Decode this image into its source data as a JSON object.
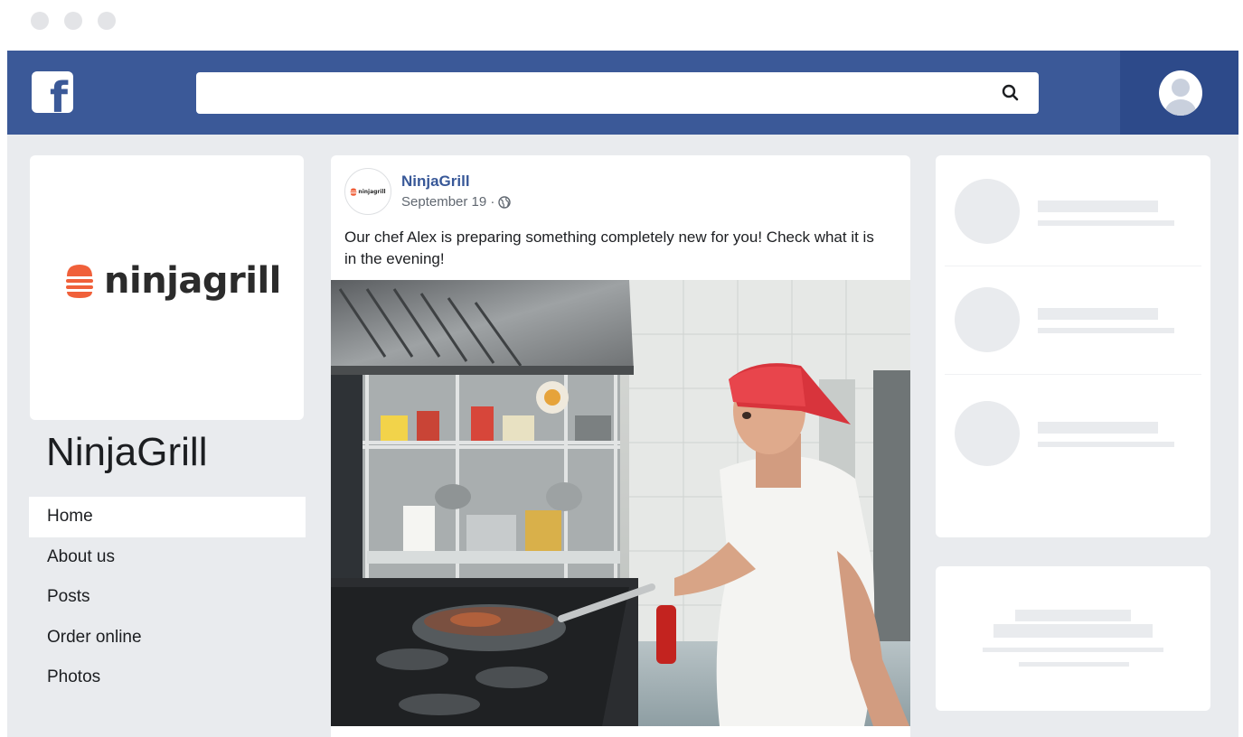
{
  "search": {
    "placeholder": "",
    "icon": "search-icon"
  },
  "brand": {
    "logo_text": "ninjagrill",
    "logo_color": "#f0603a"
  },
  "page": {
    "title": "NinjaGrill"
  },
  "nav": {
    "items": [
      {
        "label": "Home",
        "active": true
      },
      {
        "label": "About us",
        "active": false
      },
      {
        "label": "Posts",
        "active": false
      },
      {
        "label": "Order online",
        "active": false
      },
      {
        "label": "Photos",
        "active": false
      }
    ]
  },
  "post": {
    "author": "NinjaGrill",
    "avatar_text": "ninjagrill",
    "date": "September 19 ·",
    "privacy_icon": "globe-icon",
    "text": "Our chef Alex is preparing something completely new for you! Check what it is in the evening!"
  },
  "colors": {
    "fb_blue": "#3b5998",
    "fb_blue_dark": "#2d4a8a",
    "link": "#385898",
    "page_bg": "#e9ebee"
  }
}
